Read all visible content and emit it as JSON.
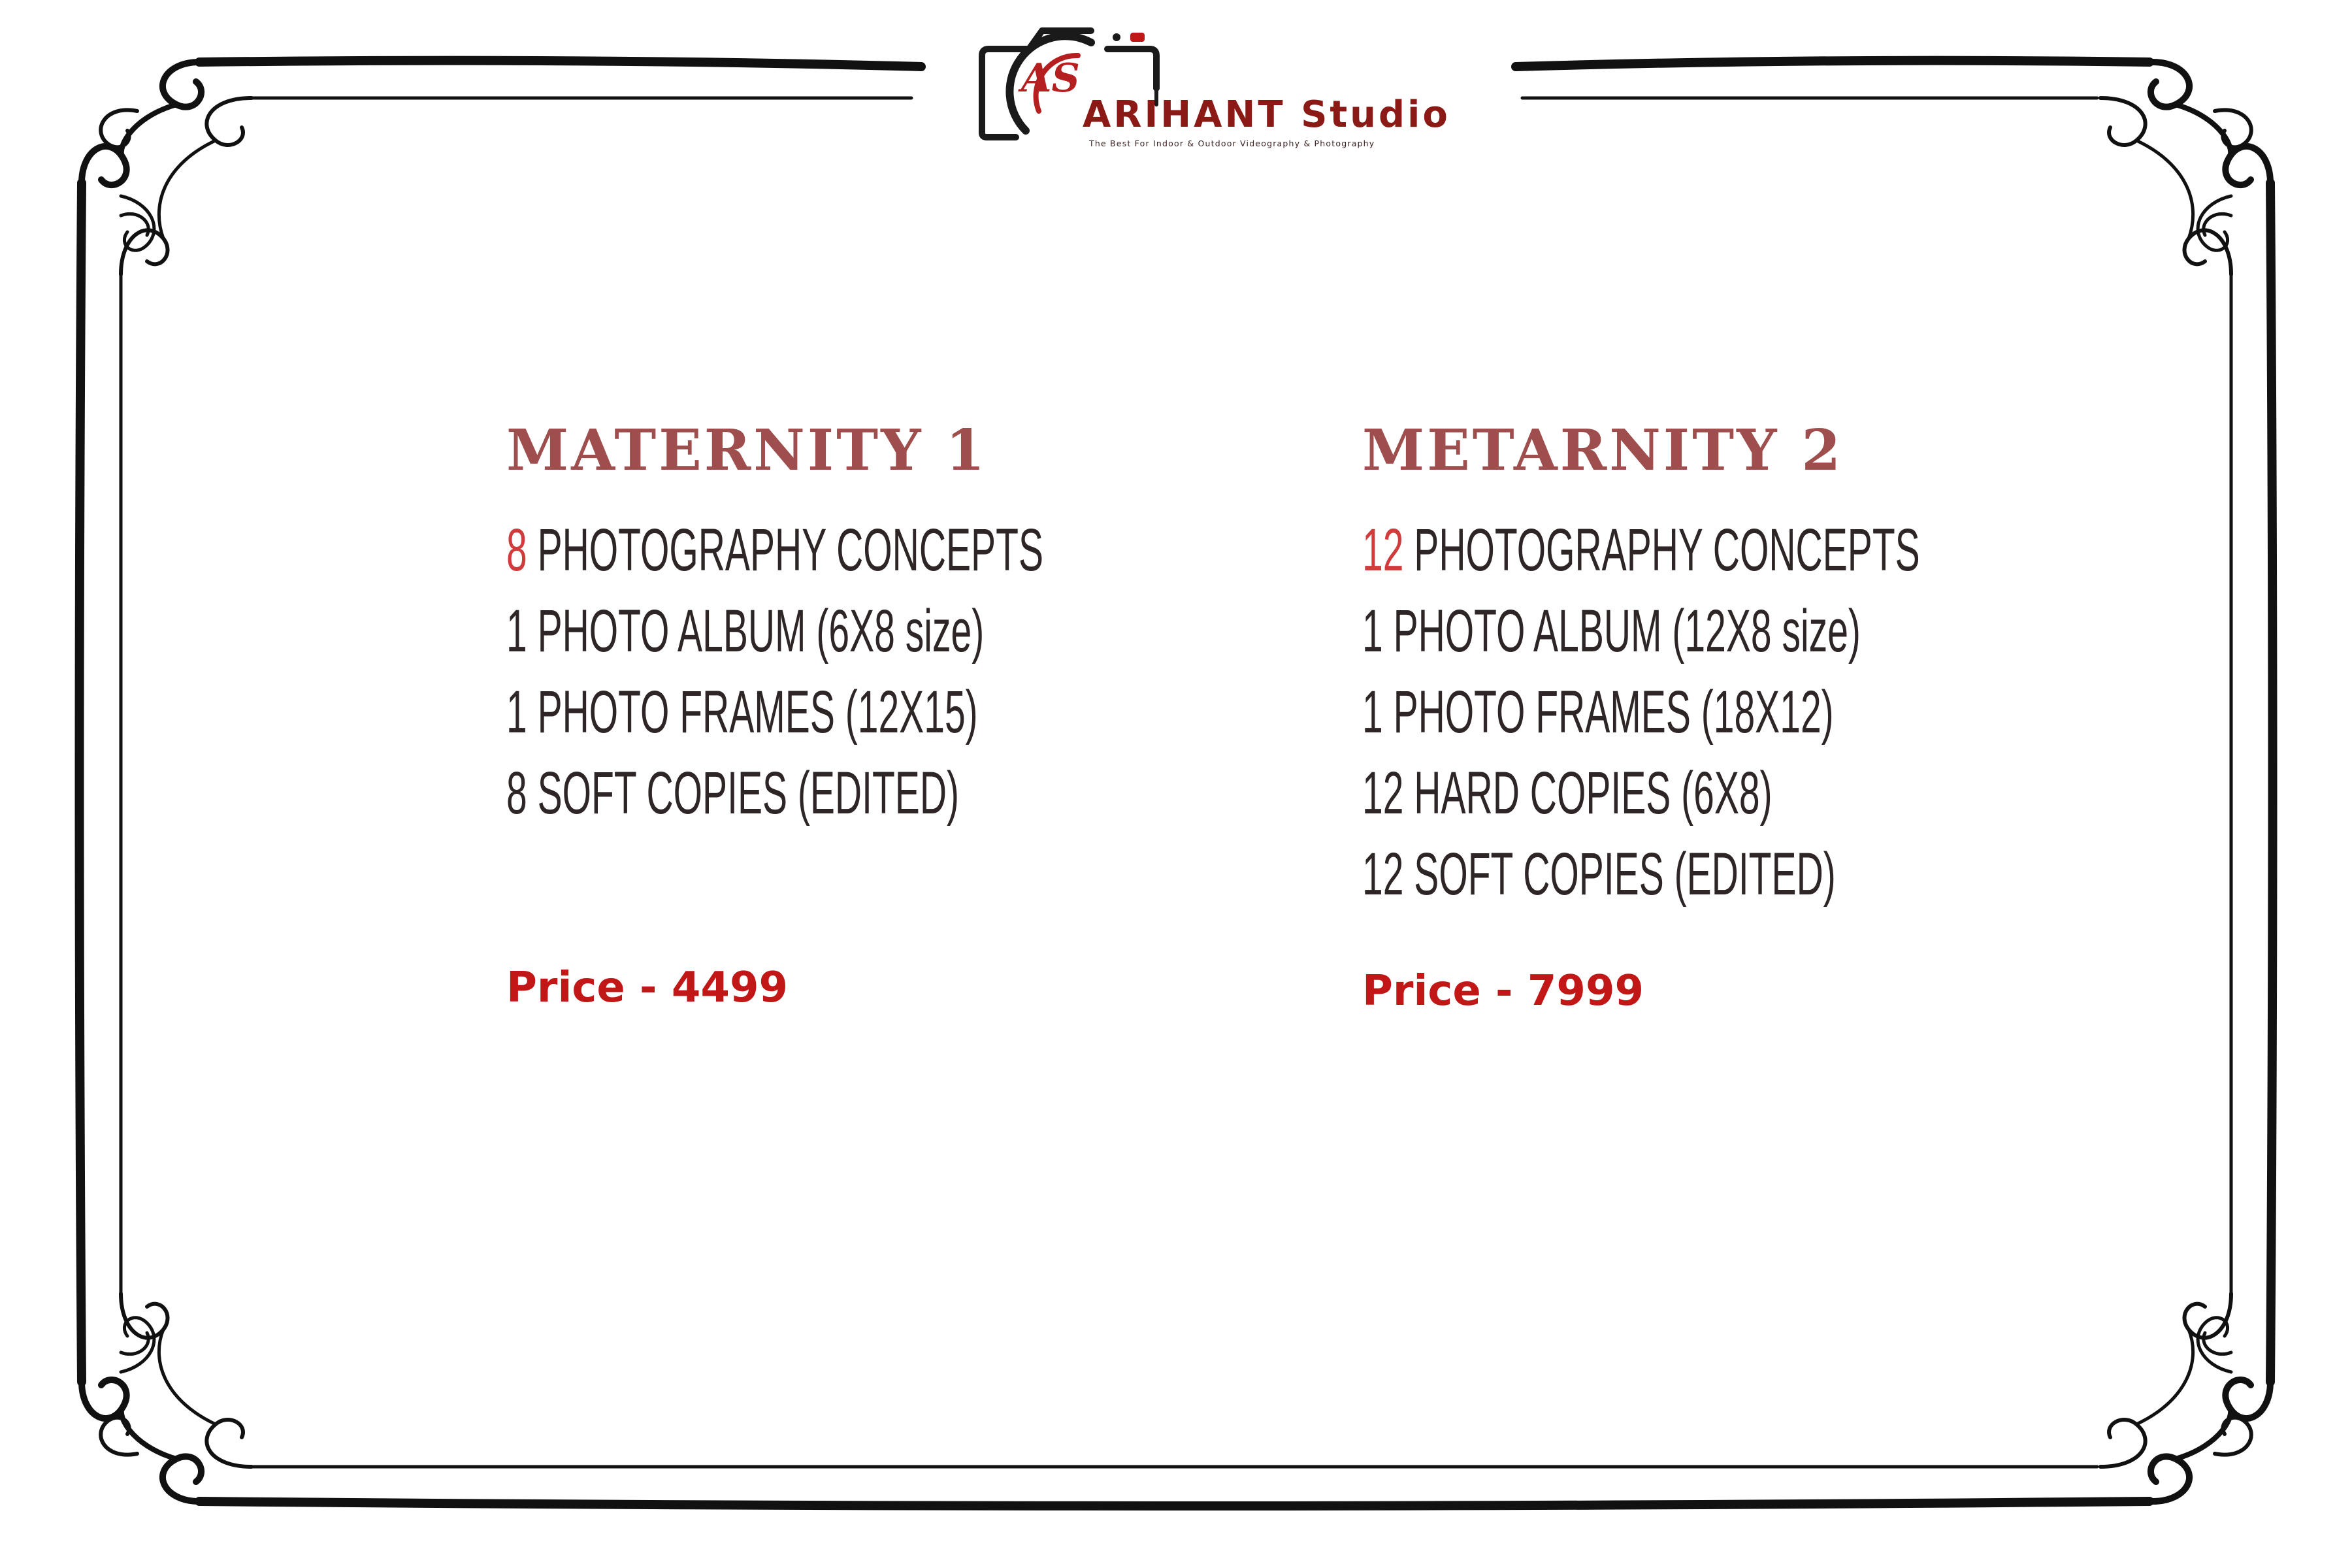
{
  "logo": {
    "initials": "AS",
    "brand": "ARIHANT Studio",
    "tagline": "The Best For Indoor & Outdoor Videography & Photography",
    "icon": "camera-icon"
  },
  "colors": {
    "title": "#9f4e4e",
    "accent": "#d03c3c",
    "price": "#c21717",
    "text": "#2e2626",
    "frame": "#111111"
  },
  "packages": [
    {
      "title": "MATERNITY 1",
      "features": [
        {
          "accent": "8",
          "text": " PHOTOGRAPHY CONCEPTS"
        },
        {
          "accent": "",
          "text": "1 PHOTO ALBUM (6X8 size)"
        },
        {
          "accent": "",
          "text": "1 PHOTO FRAMES (12X15)"
        },
        {
          "accent": "",
          "text": "8 SOFT COPIES (EDITED)"
        }
      ],
      "price": "Price - 4499"
    },
    {
      "title": "METARNITY 2",
      "features": [
        {
          "accent": "12",
          "text": " PHOTOGRAPHY CONCEPTS"
        },
        {
          "accent": "",
          "text": "1 PHOTO ALBUM (12X8 size)"
        },
        {
          "accent": "",
          "text": "1 PHOTO FRAMES (18X12)"
        },
        {
          "accent": "",
          "text": "12 HARD COPIES (6X8)"
        },
        {
          "accent": "",
          "text": "12 SOFT COPIES (EDITED)"
        }
      ],
      "price": "Price - 7999"
    }
  ]
}
